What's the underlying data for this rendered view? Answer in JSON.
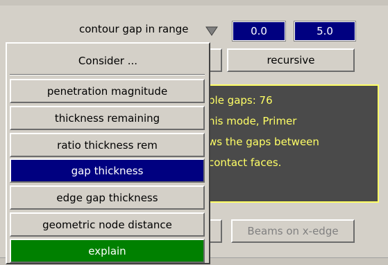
{
  "range": {
    "label": "contour gap in range",
    "min_value": "0.0",
    "max_value": "5.0"
  },
  "recursive_label": "recursive",
  "info": {
    "lines": [
      "ble gaps: 76",
      "his mode, Primer",
      "ws the gaps between",
      "contact faces."
    ]
  },
  "beams_button_label": "Beams on x-edge",
  "popup": {
    "title": "Consider ...",
    "items": [
      {
        "label": "penetration magnitude"
      },
      {
        "label": "thickness remaining"
      },
      {
        "label": "ratio thickness rem"
      },
      {
        "label": "gap thickness",
        "selected": true
      },
      {
        "label": "edge gap thickness"
      },
      {
        "label": "geometric node distance"
      }
    ],
    "explain_label": "explain"
  },
  "colors": {
    "selected": "#000080",
    "explain": "#008000",
    "info_text": "#ffff66",
    "info_bg": "#4a4a4a"
  },
  "icons": [
    "dropdown-arrow-icon"
  ]
}
